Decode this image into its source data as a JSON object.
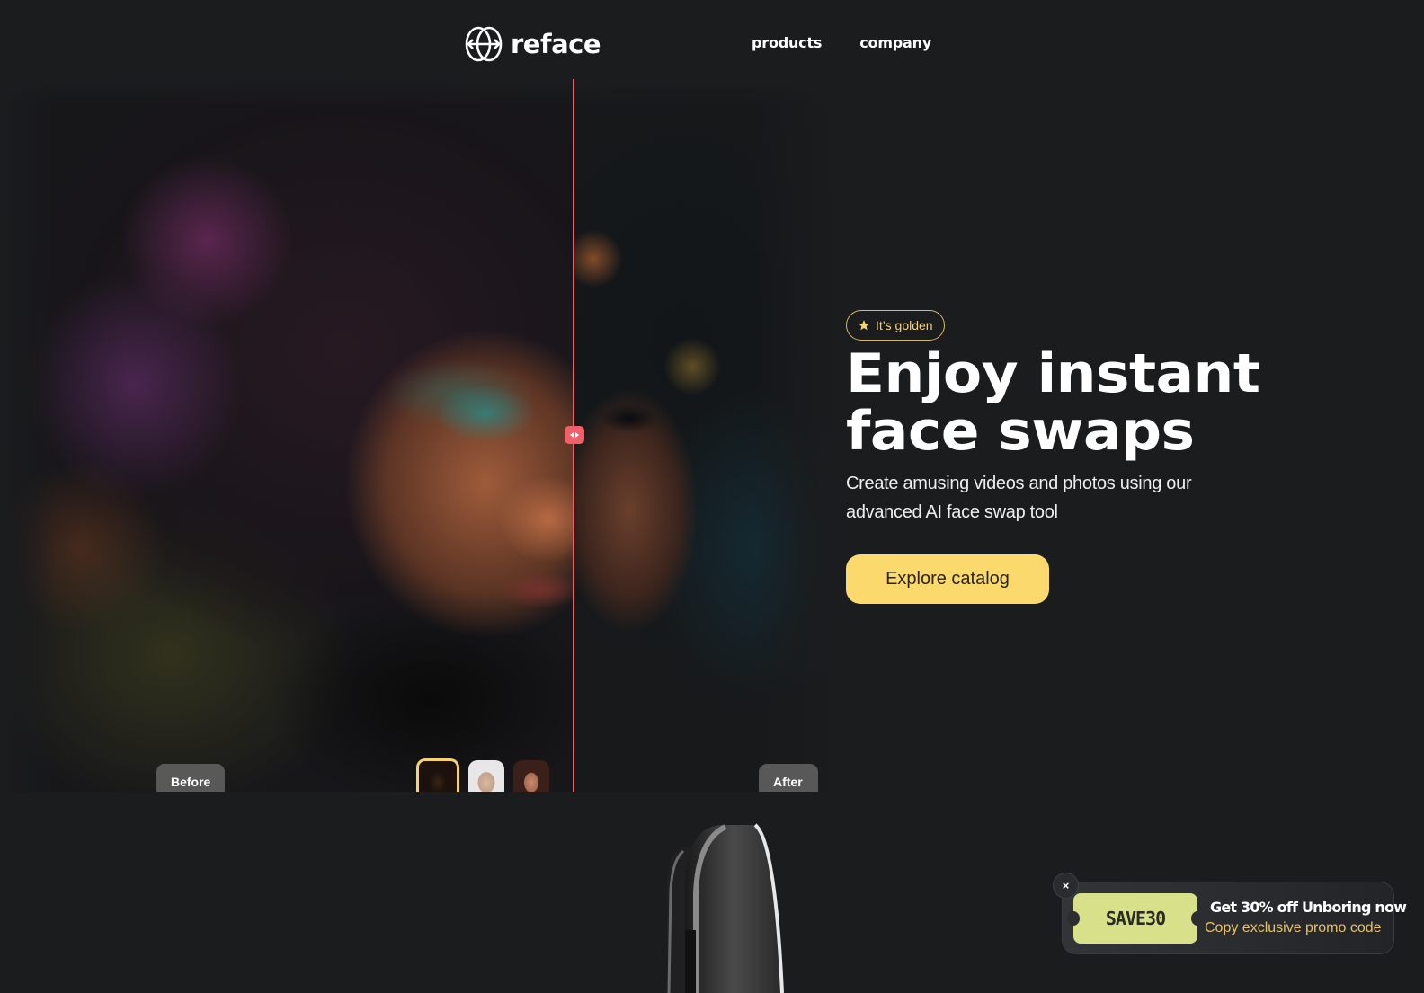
{
  "header": {
    "logo_text": "reface",
    "nav": [
      {
        "label": "products"
      },
      {
        "label": "company"
      }
    ]
  },
  "compare": {
    "before_label": "Before",
    "after_label": "After",
    "divider_position_fraction": 0.68,
    "divider_color": "#f0606a",
    "thumbnails": [
      {
        "name": "woman-platinum-hair",
        "active": true
      },
      {
        "name": "man-short-hair",
        "active": false
      },
      {
        "name": "woman-dark-hair",
        "active": false
      }
    ]
  },
  "hero": {
    "badge_icon": "star-icon",
    "badge_text": "It’s golden",
    "headline_line1": "Enjoy instant",
    "headline_line2": "face swaps",
    "subtitle": "Create amusing videos and photos using our advanced AI face swap tool",
    "cta_label": "Explore catalog",
    "accent_color": "#fbd96c"
  },
  "promo": {
    "close_label": "×",
    "coupon_code": "SAVE30",
    "title": "Get 30% off Unboring now",
    "subtitle": "Copy exclusive promo code",
    "coupon_color": "#d9e08a",
    "subtitle_color": "#e8c068"
  }
}
